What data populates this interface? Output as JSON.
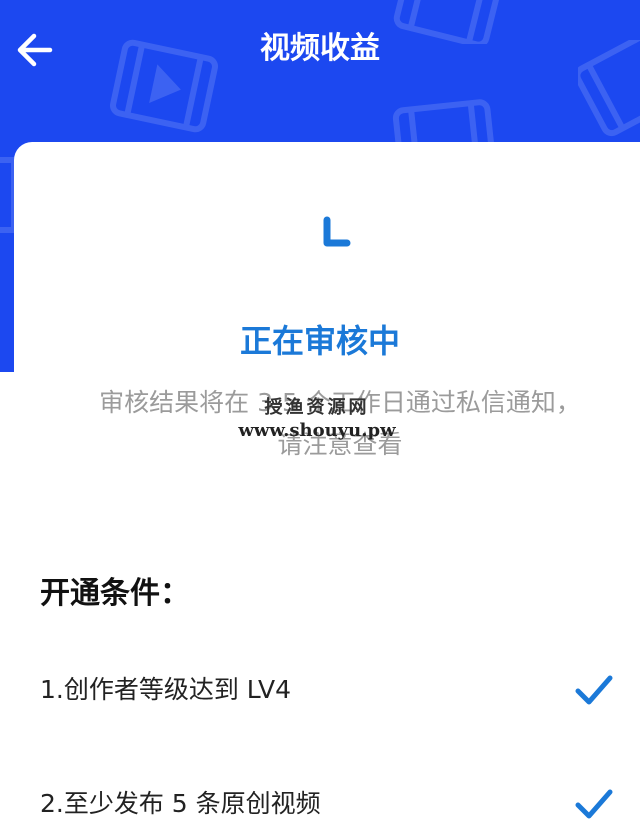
{
  "header": {
    "title": "视频收益",
    "back_icon": "arrow-left-icon",
    "background_color": "#1c48f0"
  },
  "status": {
    "icon": "loading-spinner-icon",
    "title": "正在审核中",
    "description": "审核结果将在 3-5 个工作日通过私信通知，请注意查看",
    "accent_color": "#1b79d8"
  },
  "watermark": {
    "line1": "授渔资源网",
    "line2": "www.shouyu.pw"
  },
  "conditions": {
    "title": "开通条件：",
    "items": [
      {
        "label": "1.创作者等级达到 LV4",
        "met": true,
        "icon": "check-icon"
      },
      {
        "label": "2.至少发布 5 条原创视频",
        "met": true,
        "icon": "check-icon"
      }
    ]
  }
}
